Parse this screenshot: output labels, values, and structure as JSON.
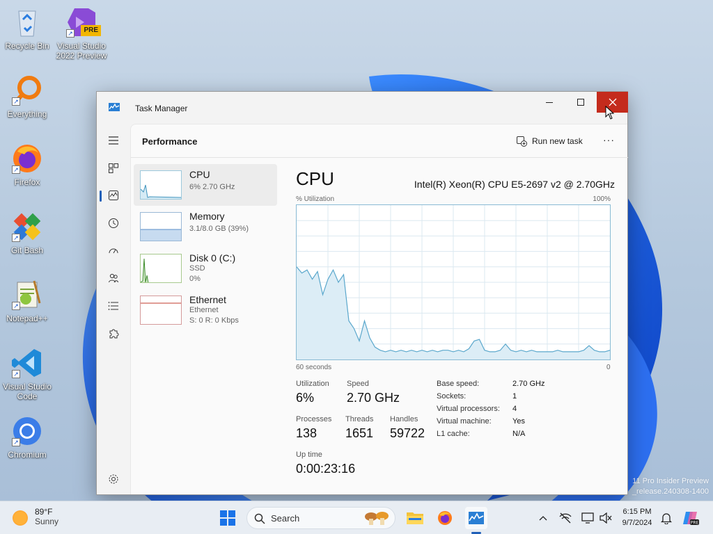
{
  "desktop": {
    "icons": [
      {
        "label": "Recycle Bin"
      },
      {
        "label": "Visual Studio 2022 Preview",
        "badge": "PRE"
      },
      {
        "label": "Everything"
      },
      {
        "label": "Firefox"
      },
      {
        "label": "Git Bash"
      },
      {
        "label": "Notepad++"
      },
      {
        "label": "Visual Studio Code"
      },
      {
        "label": "Chromium"
      }
    ],
    "watermark_line1": "11 Pro Insider Preview",
    "watermark_line2": "_release.240308-1400"
  },
  "window": {
    "title": "Task Manager",
    "header": {
      "page_title": "Performance",
      "run_task_label": "Run new task",
      "more_label": "···"
    }
  },
  "sidebar": {
    "items": [
      {
        "name": "CPU",
        "sub1": "6% 2.70 GHz"
      },
      {
        "name": "Memory",
        "sub1": "3.1/8.0 GB (39%)"
      },
      {
        "name": "Disk 0 (C:)",
        "sub1": "SSD",
        "sub2": "0%"
      },
      {
        "name": "Ethernet",
        "sub1": "Ethernet",
        "sub2": "S: 0 R: 0 Kbps"
      }
    ]
  },
  "detail": {
    "title": "CPU",
    "model": "Intel(R) Xeon(R) CPU E5-2697 v2 @ 2.70GHz",
    "y_label": "% Utilization",
    "y_max_label": "100%",
    "x_left_label": "60 seconds",
    "x_right_label": "0",
    "stats": {
      "utilization_label": "Utilization",
      "utilization": "6%",
      "speed_label": "Speed",
      "speed": "2.70 GHz",
      "processes_label": "Processes",
      "processes": "138",
      "threads_label": "Threads",
      "threads": "1651",
      "handles_label": "Handles",
      "handles": "59722",
      "uptime_label": "Up time",
      "uptime": "0:00:23:16"
    },
    "specs": [
      {
        "label": "Base speed:",
        "value": "2.70 GHz"
      },
      {
        "label": "Sockets:",
        "value": "1"
      },
      {
        "label": "Virtual processors:",
        "value": "4"
      },
      {
        "label": "Virtual machine:",
        "value": "Yes"
      },
      {
        "label": "L1 cache:",
        "value": "N/A"
      }
    ]
  },
  "chart_data": {
    "type": "area",
    "title": "",
    "xlabel": "",
    "ylabel": "% Utilization",
    "x": [
      60,
      59,
      58,
      57,
      56,
      55,
      54,
      53,
      52,
      51,
      50,
      49,
      48,
      47,
      46,
      45,
      44,
      43,
      42,
      41,
      40,
      39,
      38,
      37,
      36,
      35,
      34,
      33,
      32,
      31,
      30,
      29,
      28,
      27,
      26,
      25,
      24,
      23,
      22,
      21,
      20,
      19,
      18,
      17,
      16,
      15,
      14,
      13,
      12,
      11,
      10,
      9,
      8,
      7,
      6,
      5,
      4,
      3,
      2,
      1,
      0
    ],
    "values": [
      60,
      56,
      58,
      52,
      57,
      42,
      52,
      58,
      50,
      55,
      25,
      20,
      12,
      25,
      14,
      8,
      6,
      5,
      6,
      5,
      6,
      5,
      6,
      5,
      6,
      5,
      6,
      5,
      6,
      6,
      5,
      6,
      5,
      7,
      12,
      13,
      6,
      5,
      5,
      6,
      10,
      6,
      5,
      6,
      5,
      6,
      5,
      5,
      5,
      5,
      6,
      5,
      5,
      5,
      5,
      6,
      9,
      6,
      5,
      5,
      6
    ],
    "ylim": [
      0,
      100
    ],
    "grid": true,
    "color": "#5aa7cc"
  },
  "taskbar": {
    "weather_temp": "89°F",
    "weather_cond": "Sunny",
    "search_label": "Search",
    "time": "6:15 PM",
    "date": "9/7/2024"
  },
  "colors": {
    "accent": "#1f5fb8",
    "close_red": "#c42b1c",
    "graph_line": "#5aa7cc",
    "graph_fill": "#dcedf6"
  }
}
